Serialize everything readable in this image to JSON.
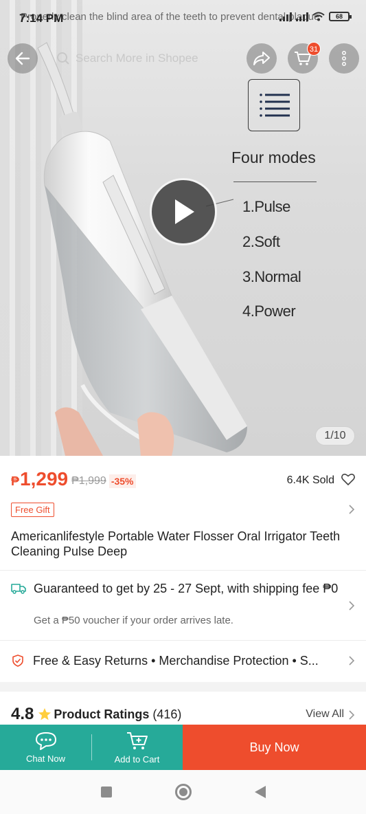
{
  "status_bar": {
    "time": "7:14 PM",
    "overlay_text": "Properly clean the blind area of the teeth to prevent dental plaque",
    "battery": "68"
  },
  "header": {
    "search_placeholder": "Search More in Shopee",
    "cart_count": "31",
    "icons": [
      "back-arrow-icon",
      "search-icon",
      "share-icon",
      "cart-icon",
      "more-vertical-icon"
    ]
  },
  "hero": {
    "modes_title": "Four modes",
    "modes": [
      "1.Pulse",
      "2.Soft",
      "3.Normal",
      "4.Power"
    ],
    "image_counter": "1/10"
  },
  "product": {
    "currency": "₱",
    "price": "1,299",
    "original_price": "₱1,999",
    "discount": "-35%",
    "sold": "6.4K Sold",
    "gift_tag": "Free Gift",
    "title": "Americanlifestyle Portable Water Flosser Oral Irrigator Teeth Cleaning Pulse Deep"
  },
  "shipping": {
    "main": "Guaranteed to get by 25 - 27 Sept, with shipping fee ₱0",
    "sub": "Get a ₱50 voucher if your order arrives late."
  },
  "returns": {
    "text": "Free & Easy Returns  •  Merchandise Protection  •  S..."
  },
  "ratings": {
    "score": "4.8",
    "label": "Product Ratings",
    "count": "(416)",
    "view_all": "View All"
  },
  "actions": {
    "chat_label": "Chat Now",
    "cart_label": "Add to Cart",
    "buy_label": "Buy Now"
  },
  "colors": {
    "brand": "#ee4d2d",
    "teal": "#26aa99"
  }
}
